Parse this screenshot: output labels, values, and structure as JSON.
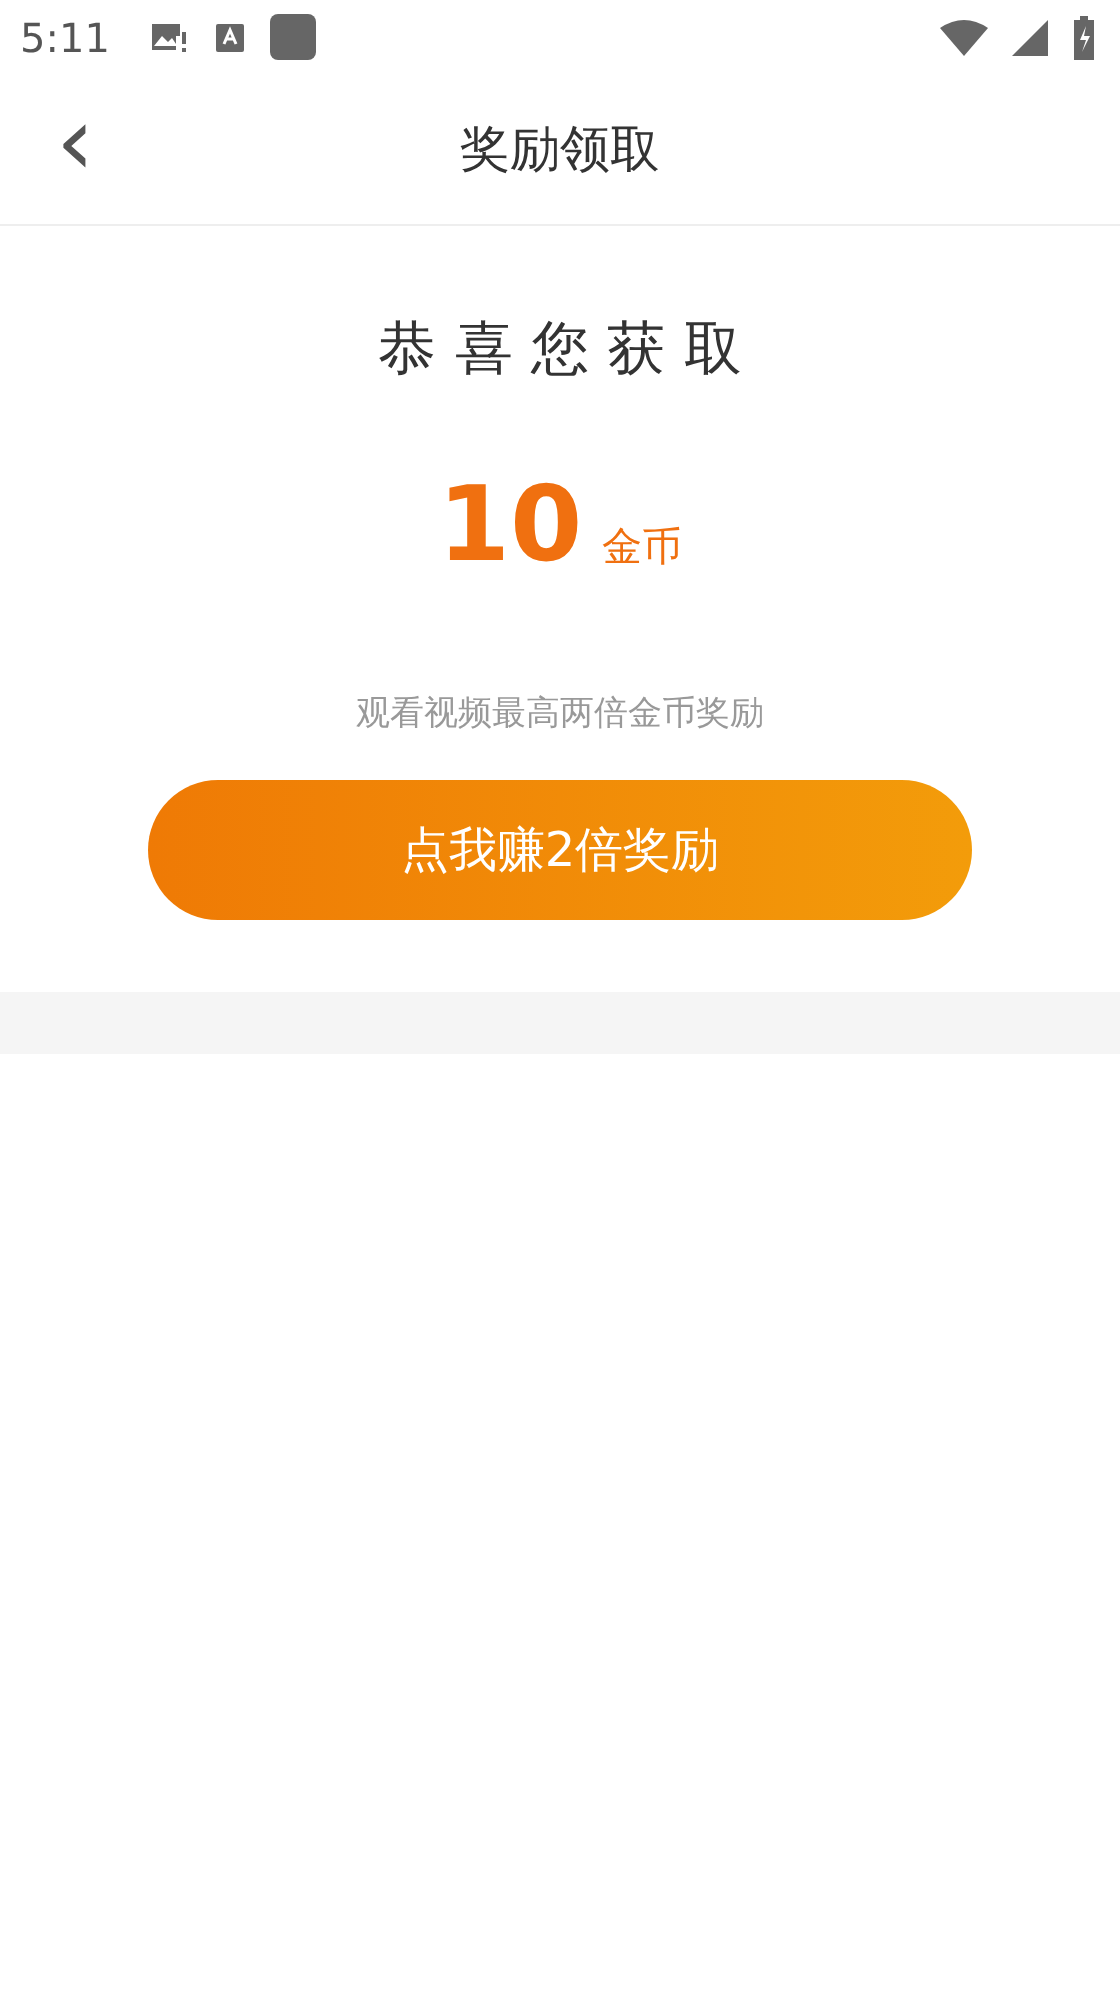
{
  "status_bar": {
    "time": "5:11"
  },
  "header": {
    "back": "‹",
    "title": "奖励领取"
  },
  "reward": {
    "heading": "恭 喜 您 获 取",
    "amount": "10",
    "unit": "金币",
    "hint": "观看视频最高两倍金币奖励",
    "button": "点我赚2倍奖励"
  }
}
